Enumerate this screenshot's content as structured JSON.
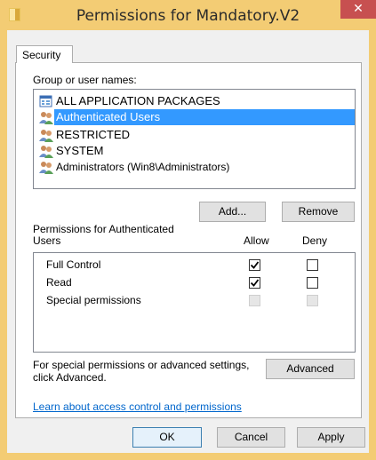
{
  "window": {
    "title": "Permissions for Mandatory.V2",
    "close_glyph": "✕",
    "frame_color": "#f3cc74"
  },
  "tabs": [
    {
      "label": "Security"
    }
  ],
  "group_list": {
    "label": "Group or user names:",
    "items": [
      {
        "label": "ALL APPLICATION PACKAGES",
        "icon": "app-packages-icon",
        "selected": false
      },
      {
        "label": "Authenticated Users",
        "icon": "users-group-icon",
        "selected": true
      },
      {
        "label": "RESTRICTED",
        "icon": "users-group-icon",
        "selected": false
      },
      {
        "label": "SYSTEM",
        "icon": "users-group-icon",
        "selected": false
      },
      {
        "label": "Administrators (Win8\\Administrators)",
        "icon": "users-group-icon",
        "selected": false
      }
    ]
  },
  "buttons": {
    "add": "Add...",
    "remove": "Remove",
    "advanced": "Advanced",
    "ok": "OK",
    "cancel": "Cancel",
    "apply": "Apply"
  },
  "permissions": {
    "header_line1": "Permissions for Authenticated",
    "header_line2": "Users",
    "allow_header": "Allow",
    "deny_header": "Deny",
    "rows": [
      {
        "label": "Full Control",
        "allow": true,
        "deny": false,
        "disabled": false
      },
      {
        "label": "Read",
        "allow": true,
        "deny": false,
        "disabled": false
      },
      {
        "label": "Special permissions",
        "allow": false,
        "deny": false,
        "disabled": true
      }
    ]
  },
  "advanced_text": {
    "line1": "For special permissions or advanced settings,",
    "line2": "click Advanced."
  },
  "help_link": "Learn about access control and permissions",
  "colors": {
    "selection": "#3399ff",
    "link": "#0066cc",
    "close_button": "#c75050"
  }
}
